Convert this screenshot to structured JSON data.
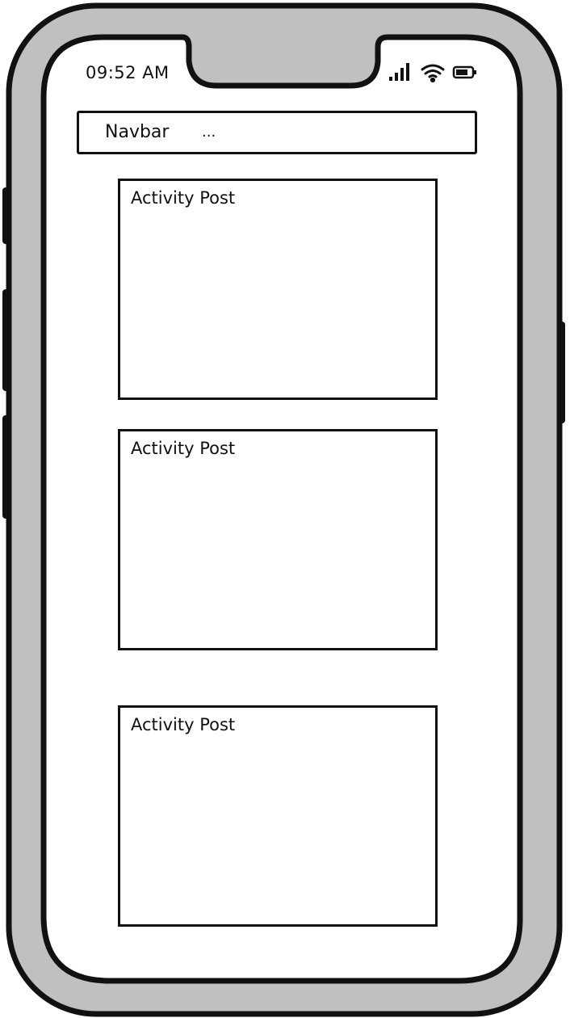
{
  "status_bar": {
    "time": "09:52 AM",
    "icons": [
      "signal-icon",
      "wifi-icon",
      "battery-icon"
    ]
  },
  "navbar": {
    "title": "Navbar",
    "more": "..."
  },
  "posts": [
    {
      "title": "Activity Post"
    },
    {
      "title": "Activity Post"
    },
    {
      "title": "Activity Post"
    }
  ],
  "colors": {
    "frame": "#c0c0c0",
    "outline": "#111111",
    "screen": "#ffffff"
  }
}
